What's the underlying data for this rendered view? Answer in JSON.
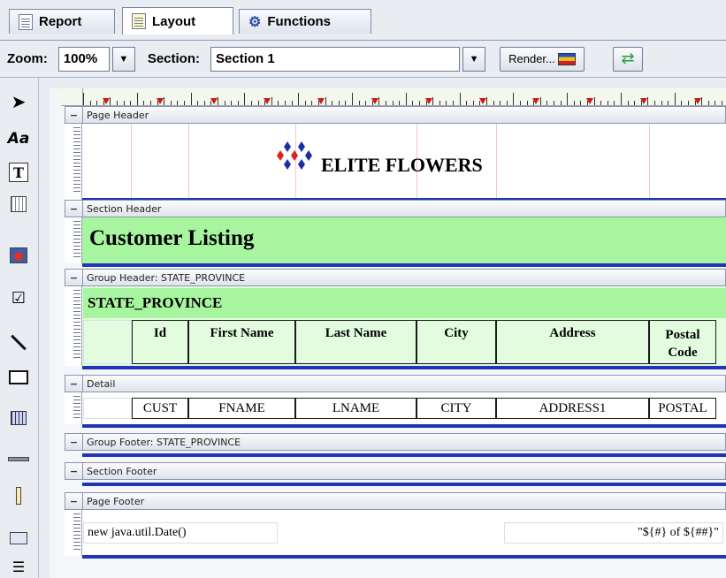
{
  "tabs": [
    {
      "label": "Report",
      "icon": "report-icon"
    },
    {
      "label": "Layout",
      "icon": "layout-icon"
    },
    {
      "label": "Functions",
      "icon": "functions-icon"
    }
  ],
  "toolbar": {
    "zoom_label": "Zoom:",
    "zoom_value": "100%",
    "section_label": "Section:",
    "section_value": "Section 1",
    "render_label": "Render..."
  },
  "palette": [
    "pointer-icon",
    "font-icon",
    "text-field-icon",
    "table-icon",
    "image-icon",
    "checkbox-icon",
    "line-icon",
    "rectangle-icon",
    "grid-icon",
    "horizontal-bar-icon",
    "vertical-bar-icon",
    "chart-icon",
    "list-icon"
  ],
  "palette_text": {
    "font": "Aa",
    "text": "T"
  },
  "bands": {
    "page_header": "Page Header",
    "section_header": "Section Header",
    "group_header": "Group Header: STATE_PROVINCE",
    "detail": "Detail",
    "group_footer": "Group Footer: STATE_PROVINCE",
    "section_footer": "Section Footer",
    "page_footer": "Page Footer"
  },
  "report": {
    "company": "ELITE FLOWERS",
    "title": "Customer Listing",
    "group_field": "STATE_PROVINCE",
    "columns": [
      "Id",
      "First Name",
      "Last Name",
      "City",
      "Address",
      "Postal Code"
    ],
    "detail_fields": [
      "CUST",
      "FNAME",
      "LNAME",
      "CITY",
      "ADDRESS1",
      "POSTAL"
    ],
    "footer_date": "new java.util.Date()",
    "footer_page": "\"${#} of ${##}\""
  },
  "colors": {
    "band_green": "#a8f5a0",
    "light_green": "#e3fce0",
    "blue_line": "#1f35b8",
    "diamond_red": "#e02020",
    "diamond_blue": "#1a2ea8"
  }
}
